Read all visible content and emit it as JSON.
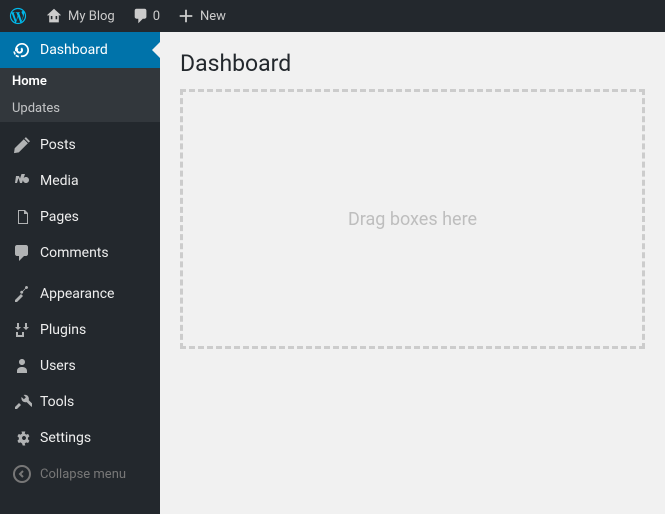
{
  "toolbar": {
    "site_name": "My Blog",
    "comments_count": "0",
    "new_label": "New"
  },
  "sidebar": {
    "items": [
      {
        "label": "Dashboard"
      },
      {
        "label": "Posts"
      },
      {
        "label": "Media"
      },
      {
        "label": "Pages"
      },
      {
        "label": "Comments"
      },
      {
        "label": "Appearance"
      },
      {
        "label": "Plugins"
      },
      {
        "label": "Users"
      },
      {
        "label": "Tools"
      },
      {
        "label": "Settings"
      }
    ],
    "submenu": {
      "home": "Home",
      "updates": "Updates"
    },
    "collapse_label": "Collapse menu"
  },
  "main": {
    "title": "Dashboard",
    "dropzone_text": "Drag boxes here"
  }
}
